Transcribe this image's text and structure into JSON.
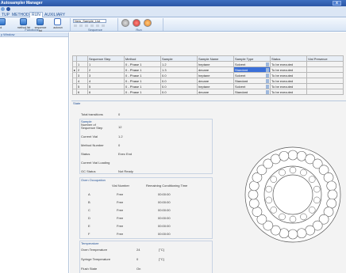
{
  "window": {
    "title": "Autosampler Manager",
    "close_label": "x"
  },
  "ribbon": {
    "tabs": [
      {
        "label": "TUP",
        "active": false
      },
      {
        "label": "METHOD",
        "active": false
      },
      {
        "label": "RUN",
        "active": true
      },
      {
        "label": "AUXILIARY",
        "active": false
      }
    ],
    "buttons": [
      "ol",
      "method list",
      "sequence list",
      "autorun"
    ],
    "sequence_name": "New_Sample_List",
    "groups": [
      "Functions",
      "Sequence",
      "Run"
    ]
  },
  "left_panel": {
    "title": "y Window"
  },
  "sequence_table": {
    "columns": [
      "",
      "",
      "Sequence Step",
      "Method",
      "Sample",
      "Sample Name",
      "Sample Type",
      "Status",
      "Vial Presence"
    ],
    "rows": [
      {
        "marker": "",
        "num": "1",
        "step": "1",
        "method": "0 - Phase 1",
        "sample": "1.2",
        "name": "heptane",
        "type": "Solvent",
        "status": "To be executed",
        "vial": ""
      },
      {
        "marker": "▸",
        "num": "2",
        "step": "2",
        "method": "0 - Phase 1",
        "sample": "1.3",
        "name": "decane",
        "type": "Standard",
        "status": "To be executed",
        "vial": ""
      },
      {
        "marker": "",
        "num": "3",
        "step": "3",
        "method": "0 - Phase 1",
        "sample": "0.0",
        "name": "heptane",
        "type": "Solvent",
        "status": "To be executed",
        "vial": ""
      },
      {
        "marker": "",
        "num": "4",
        "step": "4",
        "method": "0 - Phase 1",
        "sample": "0.0",
        "name": "decane",
        "type": "Standard",
        "status": "To be executed",
        "vial": ""
      },
      {
        "marker": "",
        "num": "5",
        "step": "5",
        "method": "0 - Phase 1",
        "sample": "0.0",
        "name": "heptane",
        "type": "Solvent",
        "status": "To be executed",
        "vial": ""
      },
      {
        "marker": "",
        "num": "6",
        "step": "6",
        "method": "0 - Phase 1",
        "sample": "0.0",
        "name": "decane",
        "type": "Standard",
        "status": "To be executed",
        "vial": ""
      }
    ]
  },
  "state": {
    "title": "State",
    "total_transitions_label": "Total transitions",
    "total_transitions": "0",
    "sample_title": "Sample",
    "num_steps_label": "Number of Sequence Step",
    "num_steps": "12",
    "current_vial_label": "Current Vial",
    "current_vial": "1.2",
    "method_number_label": "Method Number",
    "method_number": "0",
    "status_label": "Status",
    "status": "Exec End",
    "current_vial_loading_label": "Current Vial Loading",
    "current_vial_loading": "",
    "gc_status_label": "GC Status",
    "gc_status": "Not Ready",
    "oven_title": "Oven Occupation",
    "oven_headers": [
      "Vial Number",
      "Remaining Conditioning Time"
    ],
    "oven": [
      {
        "slot": "A",
        "vial": "Free",
        "time": "00:00:00"
      },
      {
        "slot": "B",
        "vial": "Free",
        "time": "00:00:00"
      },
      {
        "slot": "C",
        "vial": "Free",
        "time": "00:00:00"
      },
      {
        "slot": "D",
        "vial": "Free",
        "time": "00:00:00"
      },
      {
        "slot": "E",
        "vial": "Free",
        "time": "00:00:00"
      },
      {
        "slot": "F",
        "vial": "Free",
        "time": "00:00:00"
      }
    ],
    "temp_title": "Temperature",
    "oven_temp_label": "Oven Temperature",
    "oven_temp": "24",
    "oven_temp_unit": "[°C]",
    "syringe_temp_label": "Syringe Temperature",
    "syringe_temp": "0",
    "syringe_temp_unit": "[°C]",
    "flush_label": "Flush State",
    "flush": "On"
  },
  "colors": {
    "accent": "#2b56a6",
    "ribbon_bg": "#dbe6f5",
    "selected": "#3a6fd8"
  }
}
